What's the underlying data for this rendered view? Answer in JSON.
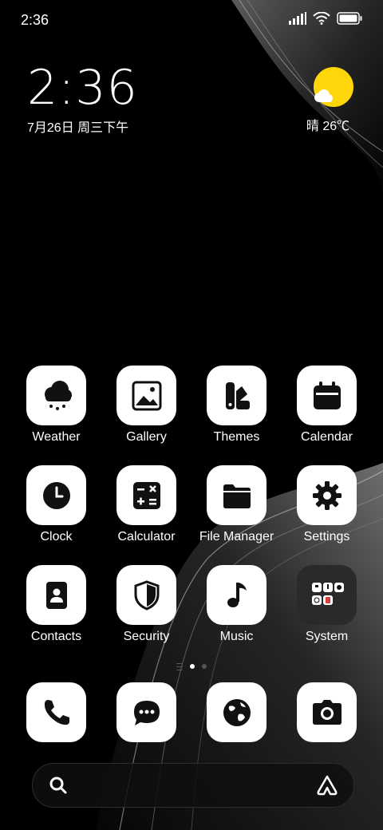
{
  "status_bar": {
    "time": "2:36",
    "icons": [
      "signal-icon",
      "wifi-icon",
      "battery-icon"
    ]
  },
  "clock_widget": {
    "time": "2:36",
    "date": "7月26日 周三下午"
  },
  "weather_widget": {
    "condition": "晴",
    "temperature": "26℃",
    "icon": "sun-with-cloud-icon"
  },
  "apps": [
    {
      "label": "Weather",
      "icon": "cloud-snow-icon"
    },
    {
      "label": "Gallery",
      "icon": "image-icon"
    },
    {
      "label": "Themes",
      "icon": "palette-icon"
    },
    {
      "label": "Calendar",
      "icon": "calendar-icon"
    },
    {
      "label": "Clock",
      "icon": "clock-icon"
    },
    {
      "label": "Calculator",
      "icon": "calculator-icon"
    },
    {
      "label": "File Manager",
      "icon": "folder-icon"
    },
    {
      "label": "Settings",
      "icon": "gear-icon"
    },
    {
      "label": "Contacts",
      "icon": "contacts-icon"
    },
    {
      "label": "Security",
      "icon": "shield-icon"
    },
    {
      "label": "Music",
      "icon": "music-note-icon"
    },
    {
      "label": "System",
      "icon": "folder-group-icon"
    }
  ],
  "dock": [
    {
      "name": "Phone",
      "icon": "phone-icon"
    },
    {
      "name": "Messages",
      "icon": "message-icon"
    },
    {
      "name": "Browser",
      "icon": "globe-icon"
    },
    {
      "name": "Camera",
      "icon": "camera-icon"
    }
  ],
  "page_indicator": {
    "pages": 2,
    "current": 1
  },
  "search_bar": {
    "left_icon": "search-icon",
    "right_icon": "assistant-icon"
  },
  "colors": {
    "background": "#000000",
    "icon_bg": "#ffffff",
    "glyph": "#111111",
    "sun": "#FFD60A"
  }
}
